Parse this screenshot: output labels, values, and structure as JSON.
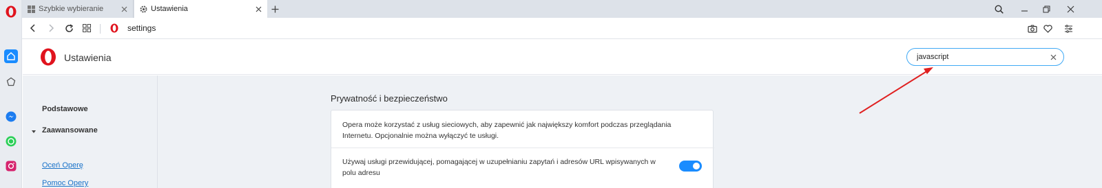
{
  "tabs": [
    {
      "label": "Szybkie wybieranie",
      "active": false,
      "icon": "grid-icon"
    },
    {
      "label": "Ustawienia",
      "active": true,
      "icon": "gear-icon"
    }
  ],
  "address": {
    "url": "settings"
  },
  "settings": {
    "title": "Ustawienia",
    "search": {
      "value": "javascript",
      "placeholder": ""
    }
  },
  "sidenav": {
    "basic": "Podstawowe",
    "advanced": "Zaawansowane",
    "rate": "Oceń Operę",
    "help": "Pomoc Opery"
  },
  "section": {
    "title": "Prywatność i bezpieczeństwo",
    "description": "Opera może korzystać z usług sieciowych, aby zapewnić jak największy komfort podczas przeglądania Internetu. Opcjonalnie można wyłączyć te usługi.",
    "setting_label": "Używaj usługi przewidującej, pomagającej w uzupełnianiu zapytań i adresów URL wpisywanych w polu adresu",
    "setting_enabled": true
  },
  "colors": {
    "accent": "#1a8cff",
    "opera_red": "#e0141e",
    "annotation_arrow": "#e02020"
  }
}
